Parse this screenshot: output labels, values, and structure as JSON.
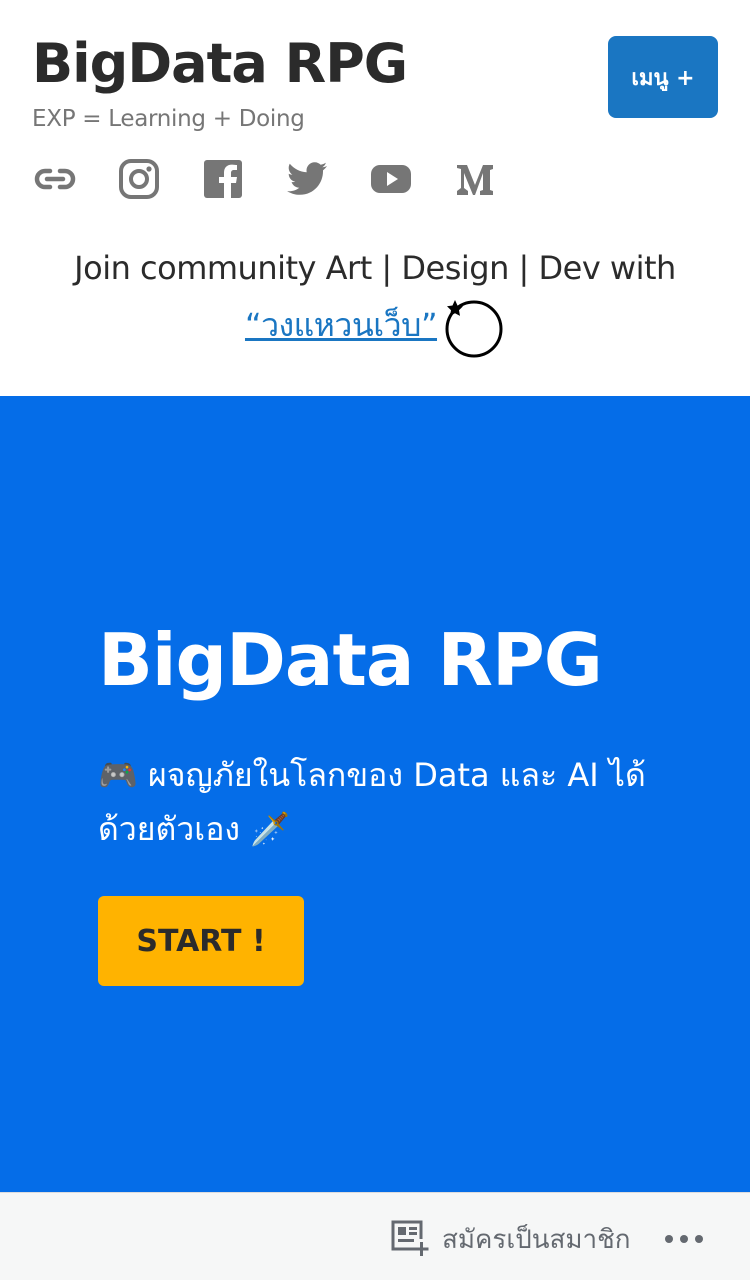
{
  "header": {
    "site_title": "BigData RPG",
    "tagline": "EXP = Learning + Doing",
    "menu_label": "เมนู +"
  },
  "social": [
    {
      "icon": "link-icon"
    },
    {
      "icon": "instagram-icon"
    },
    {
      "icon": "facebook-icon"
    },
    {
      "icon": "twitter-icon"
    },
    {
      "icon": "youtube-icon"
    },
    {
      "icon": "medium-icon"
    }
  ],
  "community": {
    "text": "Join community Art | Design | Dev with",
    "link_text": "“วงแหวนเว็บ”"
  },
  "hero": {
    "title": "BigData RPG",
    "subtitle": "🎮 ผจญภัยในโลกของ Data และ AI ได้ด้วยตัวเอง 🗡️",
    "button_label": "START !",
    "bg_color": "#056de8",
    "button_color": "#ffb300"
  },
  "bottom_bar": {
    "subscribe_label": "สมัครเป็นสมาชิก"
  },
  "colors": {
    "accent": "#1a76c2",
    "icon_gray": "#767676"
  }
}
